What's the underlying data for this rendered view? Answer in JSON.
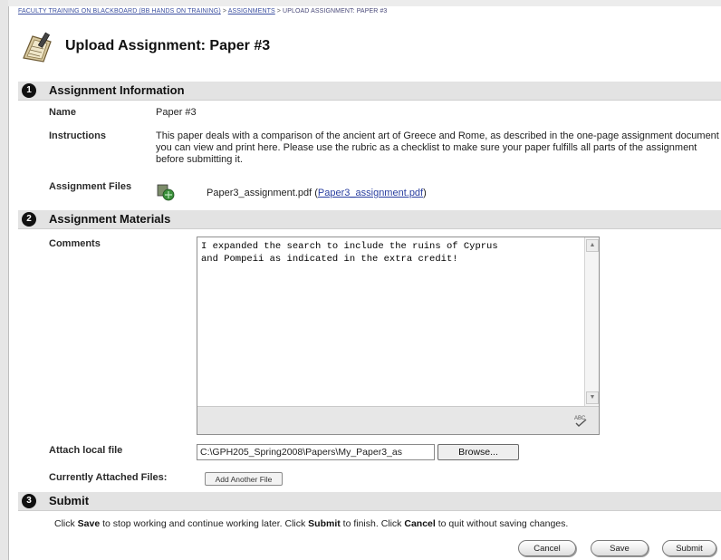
{
  "breadcrumb": {
    "items": [
      "FACULTY TRAINING ON BLACKBOARD (BB HANDS ON TRAINING)",
      "ASSIGNMENTS",
      "UPLOAD ASSIGNMENT: PAPER #3"
    ],
    "separator": ">"
  },
  "page": {
    "title": "Upload Assignment: Paper #3",
    "icon": "assignment-paper-icon"
  },
  "sections": {
    "info": {
      "number": "1",
      "title": "Assignment Information"
    },
    "materials": {
      "number": "2",
      "title": "Assignment Materials"
    },
    "submit": {
      "number": "3",
      "title": "Submit"
    }
  },
  "assignment_info": {
    "name_label": "Name",
    "name_value": "Paper #3",
    "instructions_label": "Instructions",
    "instructions_value": "This paper deals with a comparison of the ancient art of Greece and Rome, as described in the one-page assignment document you can view and print here. Please use the rubric as a checklist to make sure your paper fulfills all parts of the assignment before submitting it.",
    "files_label": "Assignment Files",
    "file_name": "Paper3_assignment.pdf",
    "file_link_open": "(",
    "file_link": "Paper3_assignment.pdf",
    "file_link_close": ")"
  },
  "materials": {
    "comments_label": "Comments",
    "comments_value": "I expanded the search to include the ruins of Cyprus\nand Pompeii as indicated in the extra credit!",
    "attach_label": "Attach local file",
    "attach_value": "C:\\GPH205_Spring2008\\Papers\\My_Paper3_as",
    "browse_label": "Browse...",
    "attached_label": "Currently Attached Files:",
    "add_file_label": "Add Another File"
  },
  "submit": {
    "text_1": "Click ",
    "save_word": "Save",
    "text_2": " to stop working and continue working later. Click ",
    "submit_word": "Submit",
    "text_3": " to finish. Click ",
    "cancel_word": "Cancel",
    "text_4": " to quit without saving changes.",
    "cancel_btn": "Cancel",
    "save_btn": "Save",
    "submit_btn": "Submit"
  }
}
